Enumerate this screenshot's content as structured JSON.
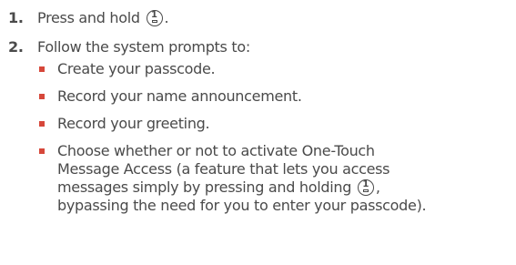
{
  "steps": [
    {
      "number": "1.",
      "text_before": "Press and hold",
      "key_icon": "voicemail-1-key-icon",
      "text_after": "."
    },
    {
      "number": "2.",
      "text": "Follow the system prompts to:",
      "bullets": [
        {
          "text": "Create your passcode."
        },
        {
          "text": "Record your name announcement."
        },
        {
          "text": "Record your greeting."
        },
        {
          "line1": "Choose whether or not to activate One-Touch",
          "line2": "Message Access (a feature that lets you access",
          "line3_before": "messages simply by pressing and holding",
          "line3_after": ",",
          "line4": "bypassing the need for you to enter your passcode)."
        }
      ]
    }
  ],
  "key_label": "1",
  "colors": {
    "text": "#4a4a4a",
    "bullet": "#d6473a"
  }
}
